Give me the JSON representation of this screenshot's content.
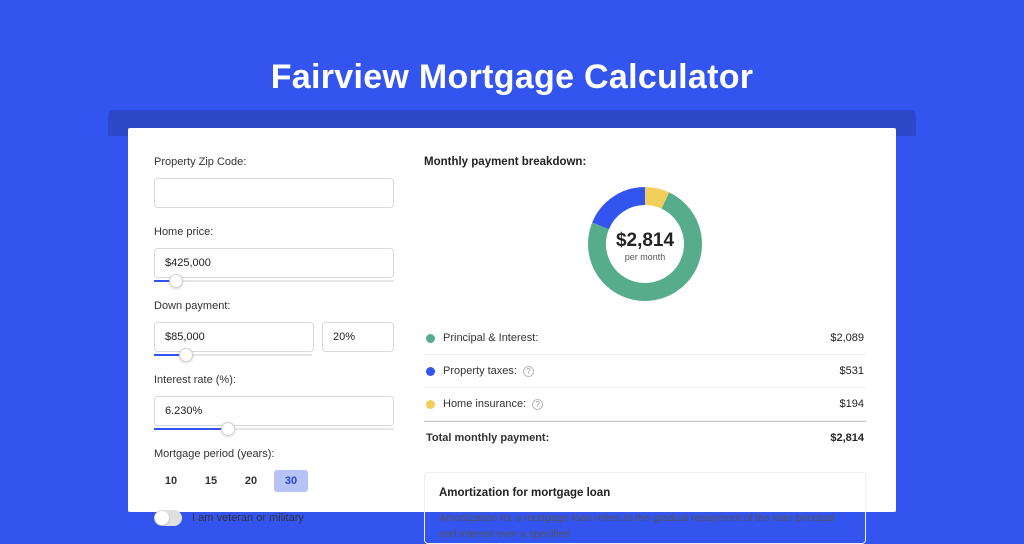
{
  "title": "Fairview Mortgage Calculator",
  "form": {
    "zip_label": "Property Zip Code:",
    "zip_value": "",
    "home_price_label": "Home price:",
    "home_price_value": "$425,000",
    "home_price_slider_pct": 9,
    "down_payment_label": "Down payment:",
    "down_payment_value": "$85,000",
    "down_payment_pct_value": "20%",
    "down_payment_slider_pct": 20,
    "interest_label": "Interest rate (%):",
    "interest_value": "6.230%",
    "interest_slider_pct": 31,
    "period_label": "Mortgage period (years):",
    "periods": [
      "10",
      "15",
      "20",
      "30"
    ],
    "period_selected": "30",
    "veteran_label": "I am veteran or military",
    "veteran_on": false
  },
  "breakdown": {
    "title": "Monthly payment breakdown:",
    "center_amount": "$2,814",
    "center_label": "per month",
    "items": [
      {
        "swatch": "green",
        "label": "Principal & Interest:",
        "value": "$2,089",
        "help": false
      },
      {
        "swatch": "blue",
        "label": "Property taxes:",
        "value": "$531",
        "help": true
      },
      {
        "swatch": "yellow",
        "label": "Home insurance:",
        "value": "$194",
        "help": true
      }
    ],
    "total_label": "Total monthly payment:",
    "total_value": "$2,814"
  },
  "chart_data": {
    "type": "pie",
    "title": "Monthly payment breakdown:",
    "series": [
      {
        "name": "Principal & Interest",
        "value": 2089,
        "color": "#56ac8b"
      },
      {
        "name": "Property taxes",
        "value": 531,
        "color": "#3354ee"
      },
      {
        "name": "Home insurance",
        "value": 194,
        "color": "#f2ce5b"
      }
    ],
    "total": 2814,
    "center_text": "$2,814 per month",
    "donut": true
  },
  "amort": {
    "title": "Amortization for mortgage loan",
    "body": "Amortization for a mortgage loan refers to the gradual repayment of the loan principal and interest over a specified"
  }
}
